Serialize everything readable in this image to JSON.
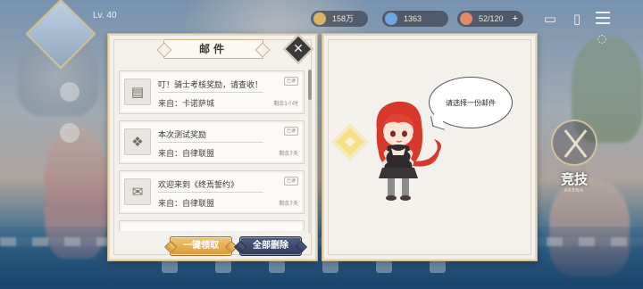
{
  "hud": {
    "level": "Lv. 40",
    "resources": [
      {
        "name": "coin",
        "value": "158万",
        "color": "#d9b567"
      },
      {
        "name": "gem",
        "value": "1363",
        "color": "#6fa6e0"
      },
      {
        "name": "stamina",
        "value": "52/120",
        "color": "#e28a6a"
      }
    ],
    "arena_label": "竞技",
    "arena_sub": "ARENA"
  },
  "mail": {
    "title": "邮件",
    "close_label": "✕",
    "items": [
      {
        "icon": "scroll-icon",
        "subject": "叮！骑士考核奖励，请查收！",
        "sender": "来自：卡诺萨城",
        "remaining": "剩余1小时",
        "tag": "已读"
      },
      {
        "icon": "gift-icon",
        "subject": "本次测试奖励",
        "sender": "来自：自律联盟",
        "remaining": "剩余7天",
        "tag": "已读"
      },
      {
        "icon": "envelope-icon",
        "subject": "欢迎来到《终焉誓约》",
        "sender": "来自：自律联盟",
        "remaining": "剩余7天",
        "tag": "已读"
      }
    ],
    "claim_all_label": "一键领取",
    "delete_all_label": "全部删除",
    "empty_prompt": "请选择一份邮件"
  },
  "colors": {
    "panel_bg": "#f4f1ec",
    "gold_button": "#e0a84a",
    "dark_button": "#3c4a6c"
  }
}
